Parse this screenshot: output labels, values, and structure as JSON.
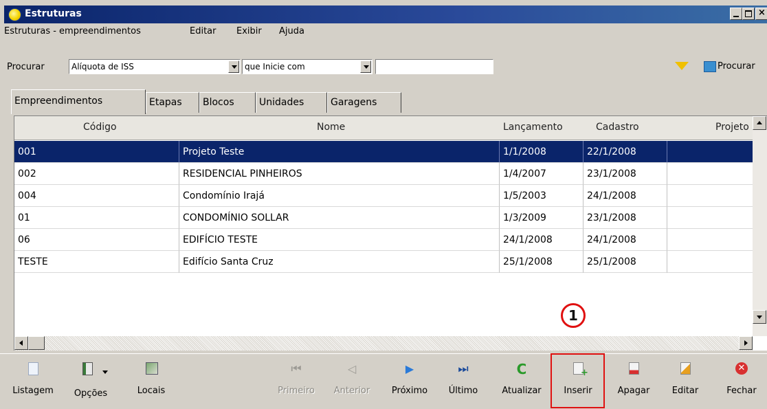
{
  "window": {
    "title": "Estruturas"
  },
  "menu": {
    "items": [
      {
        "label": "Estruturas - empreendimentos"
      },
      {
        "label": "Editar"
      },
      {
        "label": "Exibir"
      },
      {
        "label": "Ajuda"
      }
    ]
  },
  "search": {
    "label": "Procurar",
    "field_value": "Alíquota de ISS",
    "mode_value": "que Inicie com",
    "text_value": "",
    "search_button": "Procurar"
  },
  "tabs": [
    {
      "label": "Empreendimentos",
      "active": true
    },
    {
      "label": "Etapas"
    },
    {
      "label": "Blocos"
    },
    {
      "label": "Unidades"
    },
    {
      "label": "Garagens"
    }
  ],
  "grid": {
    "columns": [
      "Código",
      "Nome",
      "Lançamento",
      "Cadastro",
      "Projeto"
    ],
    "rows": [
      [
        "001",
        "Projeto Teste",
        "1/1/2008",
        "22/1/2008",
        ""
      ],
      [
        "002",
        "RESIDENCIAL PINHEIROS",
        "1/4/2007",
        "23/1/2008",
        ""
      ],
      [
        "004",
        "Condomínio Irajá",
        "1/5/2003",
        "24/1/2008",
        ""
      ],
      [
        "01",
        "CONDOMÍNIO SOLLAR",
        "1/3/2009",
        "23/1/2008",
        ""
      ],
      [
        "06",
        "EDIFÍCIO TESTE",
        "24/1/2008",
        "24/1/2008",
        ""
      ],
      [
        "TESTE",
        "Edifício Santa Cruz",
        "25/1/2008",
        "25/1/2008",
        ""
      ]
    ],
    "selected_row": 0
  },
  "annotation": {
    "number": "1",
    "color": "#e01010"
  },
  "toolbar": {
    "buttons": [
      {
        "label": "Listagem",
        "icon": "list-document-icon",
        "enabled": true
      },
      {
        "label": "Opções",
        "icon": "options-icon",
        "enabled": true
      },
      {
        "label": "Locais",
        "icon": "map-icon",
        "enabled": true
      },
      {
        "label": "Primeiro",
        "icon": "first-record-icon",
        "enabled": false
      },
      {
        "label": "Anterior",
        "icon": "previous-record-icon",
        "enabled": false
      },
      {
        "label": "Próximo",
        "icon": "next-record-icon",
        "enabled": true
      },
      {
        "label": "Último",
        "icon": "last-record-icon",
        "enabled": true
      },
      {
        "label": "Atualizar",
        "icon": "refresh-icon",
        "enabled": true
      },
      {
        "label": "Inserir",
        "icon": "insert-icon",
        "enabled": true,
        "highlighted": true
      },
      {
        "label": "Apagar",
        "icon": "delete-icon",
        "enabled": true
      },
      {
        "label": "Editar",
        "icon": "edit-icon",
        "enabled": true
      },
      {
        "label": "Fechar",
        "icon": "close-icon",
        "enabled": true
      }
    ]
  },
  "colors": {
    "selection": "#0a246a",
    "title_bar": "#0a246a",
    "highlight": "#e01010",
    "face": "#d4d0c8"
  }
}
